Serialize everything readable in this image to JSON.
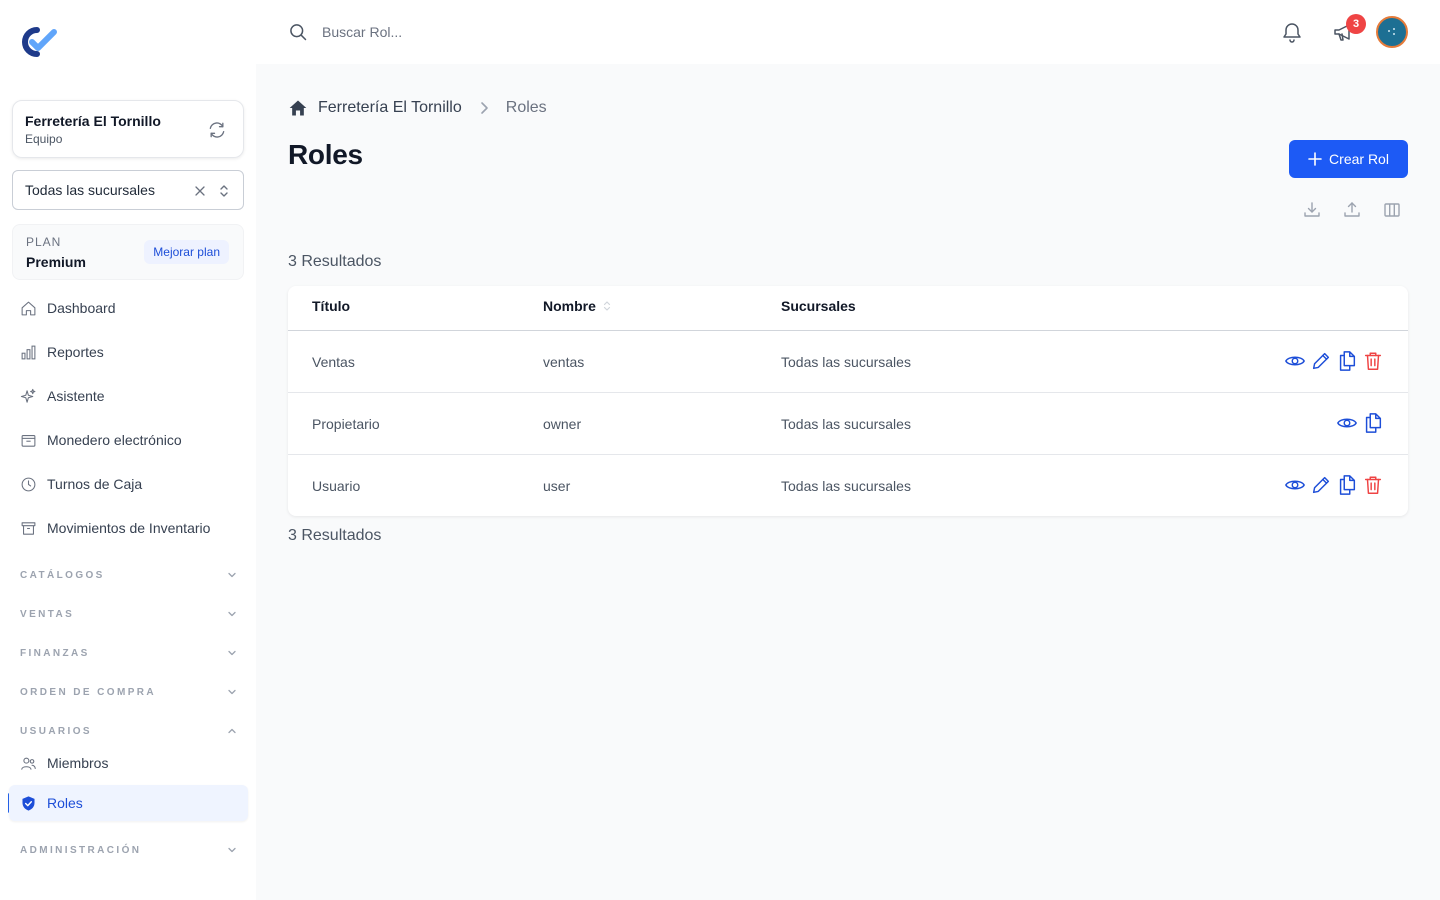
{
  "sidebar": {
    "team": {
      "name": "Ferretería El Tornillo",
      "subtitle": "Equipo"
    },
    "branch_select": {
      "value": "Todas las sucursales"
    },
    "plan": {
      "label": "PLAN",
      "name": "Premium",
      "upgrade_label": "Mejorar plan"
    },
    "nav": [
      {
        "label": "Dashboard",
        "icon": "home-icon"
      },
      {
        "label": "Reportes",
        "icon": "bar-chart-icon"
      },
      {
        "label": "Asistente",
        "icon": "sparkles-icon"
      },
      {
        "label": "Monedero electrónico",
        "icon": "wallet-icon"
      },
      {
        "label": "Turnos de Caja",
        "icon": "clock-icon"
      },
      {
        "label": "Movimientos de Inventario",
        "icon": "archive-icon"
      }
    ],
    "sections": [
      {
        "label": "CATÁLOGOS",
        "expanded": false
      },
      {
        "label": "VENTAS",
        "expanded": false
      },
      {
        "label": "FINANZAS",
        "expanded": false
      },
      {
        "label": "ORDEN DE COMPRA",
        "expanded": false
      },
      {
        "label": "USUARIOS",
        "expanded": true
      },
      {
        "label": "ADMINISTRACIÓN",
        "expanded": false
      }
    ],
    "users_items": [
      {
        "label": "Miembros",
        "icon": "users-icon",
        "active": false
      },
      {
        "label": "Roles",
        "icon": "shield-check-icon",
        "active": true
      }
    ]
  },
  "topbar": {
    "search_placeholder": "Buscar Rol...",
    "notification_badge": "3"
  },
  "main": {
    "breadcrumb": {
      "team": "Ferretería El Tornillo",
      "current": "Roles"
    },
    "title": "Roles",
    "create_button": "Crear Rol",
    "results_top": "3 Resultados",
    "results_bottom": "3 Resultados",
    "table": {
      "headers": {
        "titulo": "Título",
        "nombre": "Nombre",
        "sucursales": "Sucursales"
      },
      "rows": [
        {
          "titulo": "Ventas",
          "nombre": "ventas",
          "sucursales": "Todas las sucursales",
          "actions": [
            "view",
            "edit",
            "duplicate",
            "delete"
          ]
        },
        {
          "titulo": "Propietario",
          "nombre": "owner",
          "sucursales": "Todas las sucursales",
          "actions": [
            "view",
            "duplicate"
          ]
        },
        {
          "titulo": "Usuario",
          "nombre": "user",
          "sucursales": "Todas las sucursales",
          "actions": [
            "view",
            "edit",
            "duplicate",
            "delete"
          ]
        }
      ]
    }
  },
  "colors": {
    "primary": "#1d5af5",
    "active_text": "#1d4ed8",
    "danger": "#ef4444",
    "badge": "#ef4444"
  }
}
